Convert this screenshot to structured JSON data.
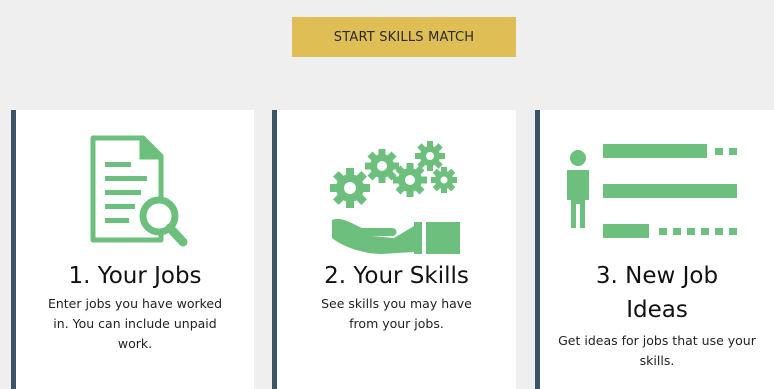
{
  "start_button": {
    "label": "START SKILLS MATCH"
  },
  "colors": {
    "accent_gold": "#dfbf55",
    "icon_green": "#6dbf7e",
    "card_border": "#3d5467",
    "background": "#efefef"
  },
  "cards": [
    {
      "icon": "document-search-icon",
      "title": "1. Your Jobs",
      "description": "Enter jobs you have worked in. You can include unpaid work."
    },
    {
      "icon": "gears-hand-icon",
      "title": "2. Your Skills",
      "description": "See skills you may have from your jobs."
    },
    {
      "icon": "person-list-icon",
      "title": "3. New Job Ideas",
      "description": "Get ideas for jobs that use your skills."
    }
  ]
}
